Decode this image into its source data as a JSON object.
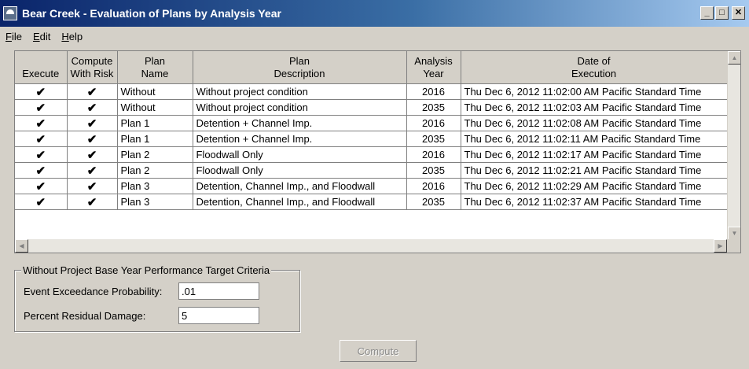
{
  "window": {
    "title": "Bear Creek - Evaluation of Plans by Analysis Year",
    "minimize": "_",
    "maximize": "□",
    "close": "✕"
  },
  "menu": [
    {
      "label": "File",
      "mnemonic": "F",
      "rest": "ile"
    },
    {
      "label": "Edit",
      "mnemonic": "E",
      "rest": "dit"
    },
    {
      "label": "Help",
      "mnemonic": "H",
      "rest": "elp"
    }
  ],
  "table": {
    "columns": [
      {
        "line1": "",
        "line2": "Execute"
      },
      {
        "line1": "Compute",
        "line2": "With Risk"
      },
      {
        "line1": "Plan",
        "line2": "Name"
      },
      {
        "line1": "Plan",
        "line2": "Description"
      },
      {
        "line1": "Analysis",
        "line2": "Year"
      },
      {
        "line1": "Date of",
        "line2": "Execution"
      }
    ],
    "check_glyph": "✔",
    "rows": [
      {
        "name": "Without",
        "description": "Without project condition",
        "year": "2016",
        "date": "Thu Dec 6, 2012 11:02:00 AM Pacific Standard Time"
      },
      {
        "name": "Without",
        "description": "Without project condition",
        "year": "2035",
        "date": "Thu Dec 6, 2012 11:02:03 AM Pacific Standard Time"
      },
      {
        "name": "Plan 1",
        "description": "Detention + Channel Imp.",
        "year": "2016",
        "date": "Thu Dec 6, 2012 11:02:08 AM Pacific Standard Time"
      },
      {
        "name": "Plan 1",
        "description": "Detention + Channel Imp.",
        "year": "2035",
        "date": "Thu Dec 6, 2012 11:02:11 AM Pacific Standard Time"
      },
      {
        "name": "Plan 2",
        "description": "Floodwall Only",
        "year": "2016",
        "date": "Thu Dec 6, 2012 11:02:17 AM Pacific Standard Time"
      },
      {
        "name": "Plan 2",
        "description": "Floodwall Only",
        "year": "2035",
        "date": "Thu Dec 6, 2012 11:02:21 AM Pacific Standard Time"
      },
      {
        "name": "Plan 3",
        "description": "Detention, Channel Imp., and Floodwall",
        "year": "2016",
        "date": "Thu Dec 6, 2012 11:02:29 AM Pacific Standard Time"
      },
      {
        "name": "Plan 3",
        "description": "Detention, Channel Imp., and Floodwall",
        "year": "2035",
        "date": "Thu Dec 6, 2012 11:02:37 AM Pacific Standard Time"
      }
    ]
  },
  "criteria": {
    "title": "Without Project Base Year Performance Target Criteria",
    "event_label": "Event Exceedance Probability:",
    "event_value": ".01",
    "residual_label": "Percent Residual Damage:",
    "residual_value": "5"
  },
  "compute_button": "Compute"
}
